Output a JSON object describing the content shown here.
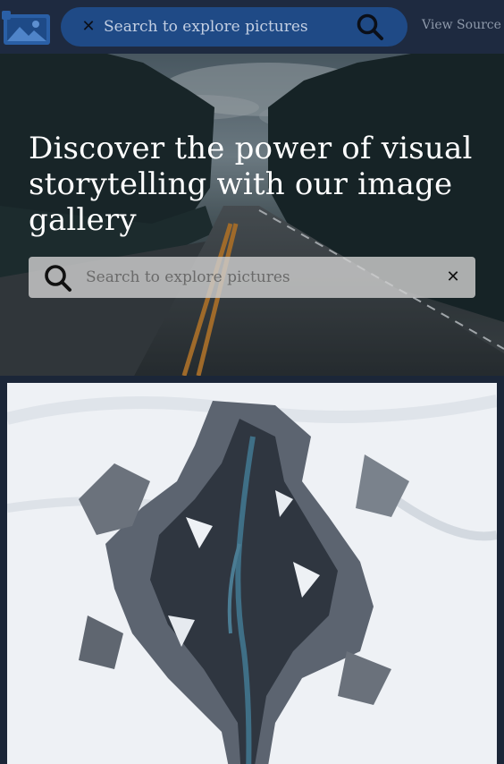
{
  "navbar": {
    "logo_icon": "image-gallery-icon",
    "search": {
      "placeholder": "Search to explore pictures",
      "value": "",
      "clear_icon": "close-icon",
      "submit_icon": "search-icon"
    },
    "view_source_label": "View Source"
  },
  "hero": {
    "title": "Discover the power of visual storytelling with our image gallery",
    "search": {
      "placeholder": "Search to explore pictures",
      "value": "",
      "submit_icon": "search-icon",
      "clear_icon": "close-icon"
    }
  },
  "gallery": {
    "images": [
      {
        "subject": "aerial view of snowy mountain ravine with river"
      }
    ]
  },
  "colors": {
    "page_background": "#1b2638",
    "navbar_background": "#1e2a40",
    "nav_search_background": "#1f4a86",
    "link": "#8e99aa"
  }
}
